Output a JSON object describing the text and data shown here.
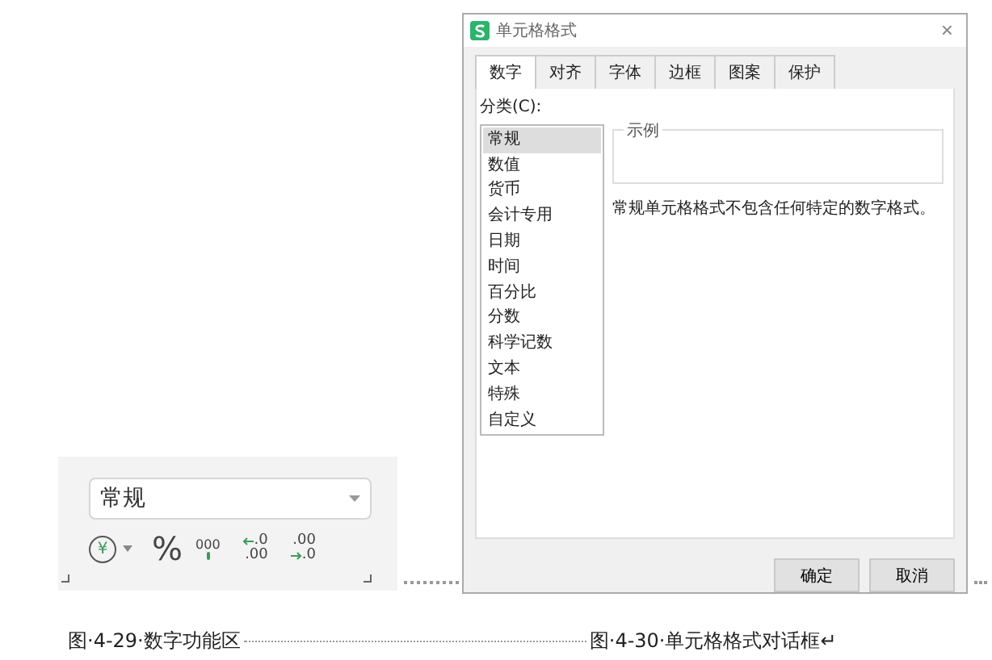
{
  "ribbon": {
    "number_format": "常规",
    "buttons": [
      {
        "kind": "currency",
        "label": "¥"
      },
      {
        "kind": "percent",
        "label": "%"
      },
      {
        "kind": "thousands",
        "label": "000"
      },
      {
        "kind": "increase_decimal",
        "top": ".0",
        "bottom": ".00"
      },
      {
        "kind": "decrease_decimal",
        "top": ".00",
        "bottom": ".0"
      }
    ]
  },
  "dialog": {
    "title": "单元格格式",
    "close": "×",
    "tabs": [
      {
        "label": "数字",
        "selected": true
      },
      {
        "label": "对齐",
        "selected": false
      },
      {
        "label": "字体",
        "selected": false
      },
      {
        "label": "边框",
        "selected": false
      },
      {
        "label": "图案",
        "selected": false
      },
      {
        "label": "保护",
        "selected": false
      }
    ],
    "category_label": "分类(C):",
    "categories": [
      {
        "label": "常规",
        "selected": true
      },
      {
        "label": "数值",
        "selected": false
      },
      {
        "label": "货币",
        "selected": false
      },
      {
        "label": "会计专用",
        "selected": false
      },
      {
        "label": "日期",
        "selected": false
      },
      {
        "label": "时间",
        "selected": false
      },
      {
        "label": "百分比",
        "selected": false
      },
      {
        "label": "分数",
        "selected": false
      },
      {
        "label": "科学记数",
        "selected": false
      },
      {
        "label": "文本",
        "selected": false
      },
      {
        "label": "特殊",
        "selected": false
      },
      {
        "label": "自定义",
        "selected": false
      }
    ],
    "sample_label": "示例",
    "description": "常规单元格格式不包含任何特定的数字格式。",
    "buttons": [
      "确定",
      "取消"
    ]
  },
  "captions": [
    "图·4-29·数字功能区",
    "图·4-30·单元格格式对话框↵"
  ]
}
